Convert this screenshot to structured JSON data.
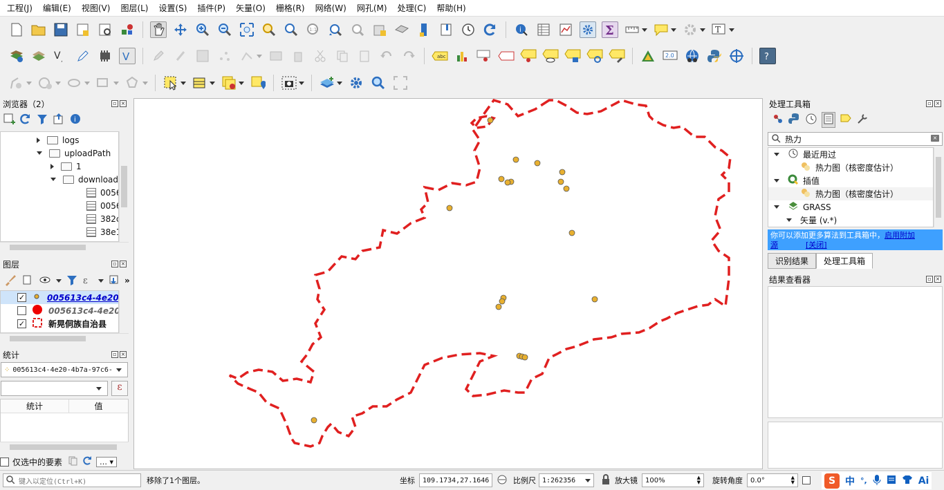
{
  "menu": [
    "工程(J)",
    "编辑(E)",
    "视图(V)",
    "图层(L)",
    "设置(S)",
    "插件(P)",
    "矢量(O)",
    "栅格(R)",
    "网络(W)",
    "网孔(M)",
    "处理(C)",
    "帮助(H)"
  ],
  "browser": {
    "title": "浏览器（2）",
    "items": [
      {
        "label": "logs",
        "indent": 68,
        "type": "folder",
        "expand": "right"
      },
      {
        "label": "uploadPath",
        "indent": 68,
        "type": "folder",
        "expand": "down"
      },
      {
        "label": "1",
        "indent": 88,
        "type": "folder",
        "expand": "right"
      },
      {
        "label": "download",
        "indent": 88,
        "type": "folder",
        "expand": "down"
      },
      {
        "label": "0056",
        "indent": 124,
        "type": "table"
      },
      {
        "label": "0056",
        "indent": 124,
        "type": "table"
      },
      {
        "label": "382c",
        "indent": 124,
        "type": "table"
      },
      {
        "label": "38e1",
        "indent": 124,
        "type": "table"
      }
    ]
  },
  "layers": {
    "title": "图层",
    "items": [
      {
        "label": "005613c4-4e20-",
        "checked": true,
        "style": "link"
      },
      {
        "label": "005613c4-4e20-",
        "checked": false,
        "style": "italic"
      },
      {
        "label": "新晃侗族自治县",
        "checked": true,
        "style": "bold"
      }
    ]
  },
  "stats": {
    "title": "统计",
    "layer_select": "005613c4-4e20-4b7a-97c6-",
    "col_stat": "统计",
    "col_value": "值",
    "selected_only": "仅选中的要素",
    "more": "…"
  },
  "toolbox": {
    "title": "处理工具箱",
    "search": "热力",
    "tree": [
      {
        "label": "最近用过",
        "level": 0,
        "icon": "clock-icon"
      },
      {
        "label": "热力图（核密度估计）",
        "level": 1,
        "icon": "heatmap-icon"
      },
      {
        "label": "插值",
        "level": 0,
        "icon": "qgis-icon"
      },
      {
        "label": "热力图（核密度估计）",
        "level": 1,
        "icon": "heatmap-icon"
      },
      {
        "label": "GRASS",
        "level": 0,
        "icon": "grass-icon"
      },
      {
        "label": "矢量 (v.*)",
        "level": 1,
        "icon": ""
      }
    ],
    "notice_text": "你可以添加更多算法到工具箱中，",
    "notice_link": "启用附加",
    "notice_link2": "源",
    "notice_close": "[关闭]",
    "tabs": [
      "识别结果",
      "处理工具箱"
    ]
  },
  "results": {
    "title": "结果查看器"
  },
  "status": {
    "locate_placeholder": "键入以定位(Ctrl+K)",
    "message": "移除了1个图层。",
    "coord_label": "坐标",
    "coord_value": "109.1734,27.1646",
    "scale_label": "比例尺",
    "scale_value": "1:262356",
    "mag_label": "放大镜",
    "mag_value": "100%",
    "rot_label": "旋转角度",
    "rot_value": "0.0°"
  },
  "ime": {
    "lang": "中"
  },
  "colors": {
    "boundary": "#e02020",
    "point": "#e8b030",
    "link": "#0000cc",
    "notice": "#3ea0ff"
  }
}
